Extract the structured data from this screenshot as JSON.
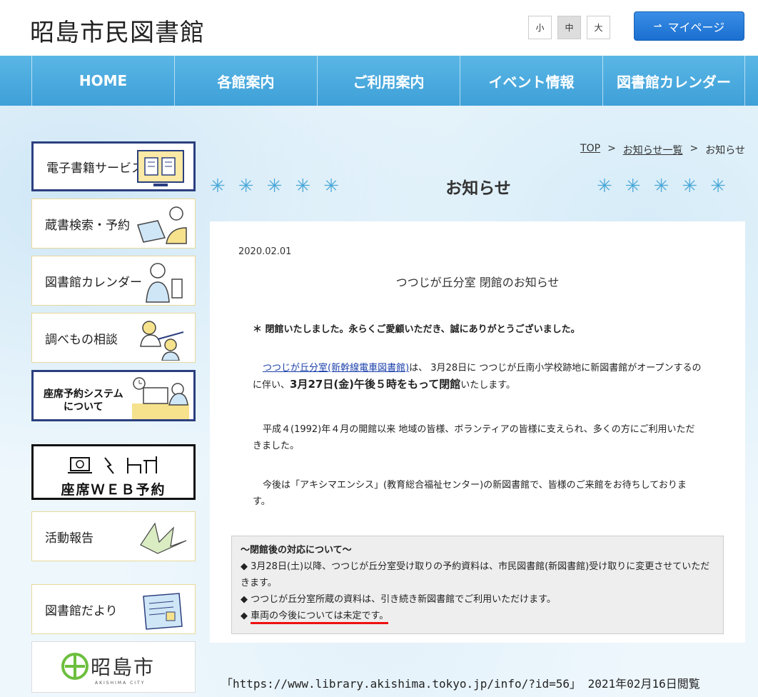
{
  "header": {
    "logo": "昭島市民図書館",
    "font_sizes": [
      "小",
      "中",
      "大"
    ],
    "mypage_label": "マイページ"
  },
  "nav": [
    "HOME",
    "各館案内",
    "ご利用案内",
    "イベント情報",
    "図書館カレンダー"
  ],
  "sidebar": {
    "items": [
      {
        "label": "電子書籍サービス"
      },
      {
        "label": "蔵書検索・予約"
      },
      {
        "label": "図書館カレンダー"
      },
      {
        "label": "調べもの相談"
      },
      {
        "label": "座席予約システム\nについて"
      }
    ],
    "web_reserve_label": "座席ＷＥＢ予約",
    "activity_label": "活動報告",
    "newsletter_label": "図書館だより",
    "city_name": "昭島市",
    "city_sub": "AKISHIMA CITY"
  },
  "breadcrumb": {
    "top": "TOP",
    "list": "お知らせ一覧",
    "current": "お知らせ",
    "sep": ">"
  },
  "page_heading": "お知らせ",
  "post": {
    "date": "2020.02.01",
    "title": "つつじが丘分室 閉館のお知らせ",
    "p1": "＊ 閉館いたしました。永らくご愛顧いただき、誠にありがとうございました。",
    "p2_link": "つつじが丘分室(新幹線電車図書館)",
    "p2_a": "は、 3月28日に つつじが丘南小学校跡地に新図書館がオープンするのに伴い、",
    "p2_b": "3月27日(金)午後５時をもって閉館",
    "p2_c": "いたします。",
    "p3": "平成４(1992)年４月の開館以来 地域の皆様、ボランティアの皆様に支えられ、多くの方にご利用いただきました。",
    "p4": "今後は「アキシマエンシス」(教育総合福祉センター)の新図書館で、皆様のご来館をお待ちしております。"
  },
  "notice": {
    "heading": "～閉館後の対応について～",
    "items": [
      "◆ 3月28日(土)以降、つつじが丘分室受け取りの予約資料は、市民図書館(新図書館)受け取りに変更させていただきます。",
      "◆ つつじが丘分室所蔵の資料は、引き続き新図書館でご利用いただけます。",
      "◆",
      "車両の今後については未定です。"
    ]
  },
  "caption": "「https://www.library.akishima.tokyo.jp/info/?id=56」 2021年02月16日閲覧"
}
